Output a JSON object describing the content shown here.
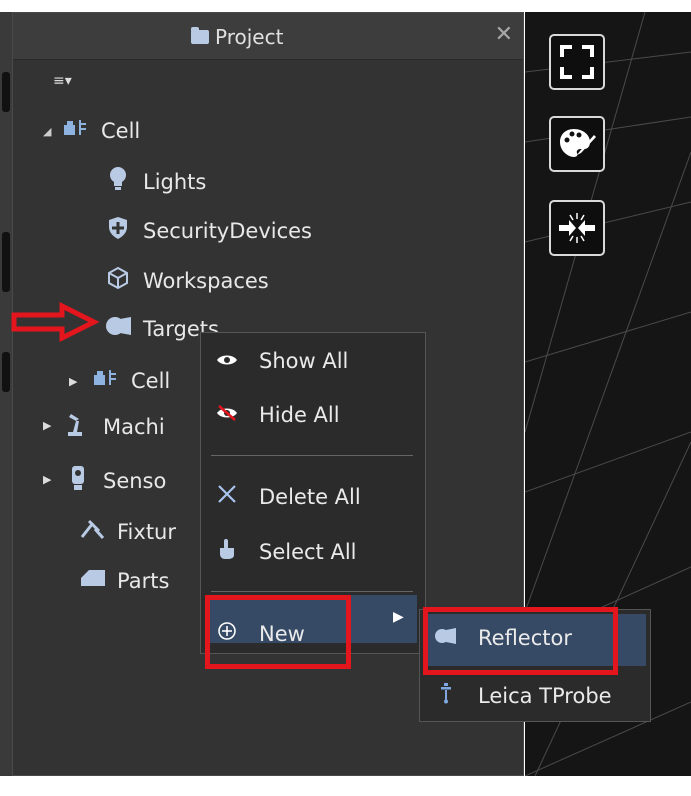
{
  "panel": {
    "title": "Project",
    "close_glyph": "✕",
    "menu_glyph": "≡▾"
  },
  "tree": {
    "items": [
      {
        "label": "Cell",
        "icon": "cell-icon"
      },
      {
        "label": "Lights",
        "icon": "bulb-icon"
      },
      {
        "label": "SecurityDevices",
        "icon": "shield-icon"
      },
      {
        "label": "Workspaces",
        "icon": "cube-icon"
      },
      {
        "label": "Targets",
        "icon": "target-icon"
      },
      {
        "label": "Cell",
        "icon": "cell-icon"
      },
      {
        "label": "Machi",
        "icon": "robot-arm-icon"
      },
      {
        "label": "Senso",
        "icon": "sensor-icon"
      },
      {
        "label": "Fixtur",
        "icon": "fixture-icon"
      },
      {
        "label": "Parts",
        "icon": "part-icon"
      }
    ]
  },
  "context_menu": {
    "show_all": "Show All",
    "hide_all": "Hide All",
    "delete_all": "Delete All",
    "select_all": "Select All",
    "new": "New"
  },
  "submenu": {
    "reflector": "Reflector",
    "leica_tprobe": "Leica TProbe"
  },
  "colors": {
    "panel_bg": "#333333",
    "menu_bg": "#2b2b2b",
    "highlight_row": "#364a66",
    "annotation_red": "#e3151d"
  }
}
